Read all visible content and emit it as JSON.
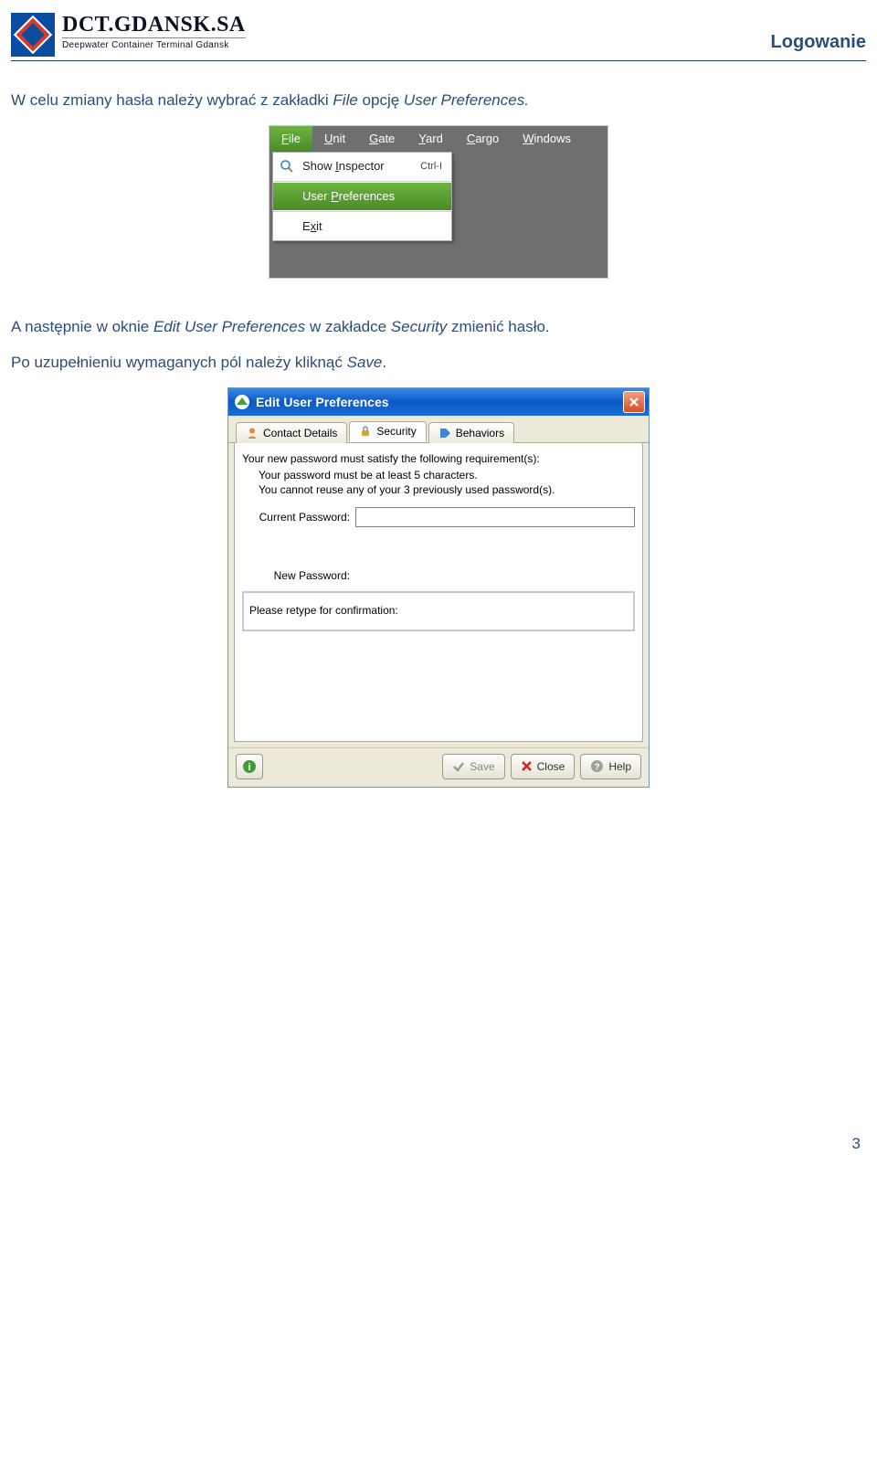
{
  "header": {
    "brand_top": "DCT.GDANSK.SA",
    "brand_sub": "Deepwater Container Terminal Gdansk",
    "page_title": "Logowanie"
  },
  "para1": {
    "p1_a": "W celu zmiany hasła należy wybrać z zakładki ",
    "p1_b": "File",
    "p1_c": " opcję ",
    "p1_d": "User Preferences.",
    "p2_a": "A następnie w oknie ",
    "p2_b": "Edit User Preferences",
    "p2_c": " w zakładce ",
    "p2_d": "Security",
    "p2_e": " zmienić hasło.",
    "p3_a": "Po uzupełnieniu wymaganych pól należy kliknąć ",
    "p3_b": "Save",
    "p3_c": "."
  },
  "shot1": {
    "menu": {
      "file": "File",
      "unit": "Unit",
      "gate": "Gate",
      "yard": "Yard",
      "cargo": "Cargo",
      "windows": "Windows"
    },
    "dropdown": {
      "show_inspector": "Show Inspector",
      "show_inspector_short": "Ctrl-I",
      "user_prefs": "User Preferences",
      "exit": "Exit"
    }
  },
  "shot2": {
    "title": "Edit User Preferences",
    "tabs": {
      "contact": "Contact Details",
      "security": "Security",
      "behaviors": "Behaviors"
    },
    "req_head": "Your new password must satisfy the following requirement(s):",
    "req1": "Your password must be at least 5 characters.",
    "req2": "You cannot reuse any of your 3 previously used password(s).",
    "current_label": "Current Password:",
    "new_label": "New Password:",
    "retype_label": "Please retype for confirmation:",
    "buttons": {
      "save": "Save",
      "close": "Close",
      "help": "Help"
    }
  },
  "page_number": "3"
}
